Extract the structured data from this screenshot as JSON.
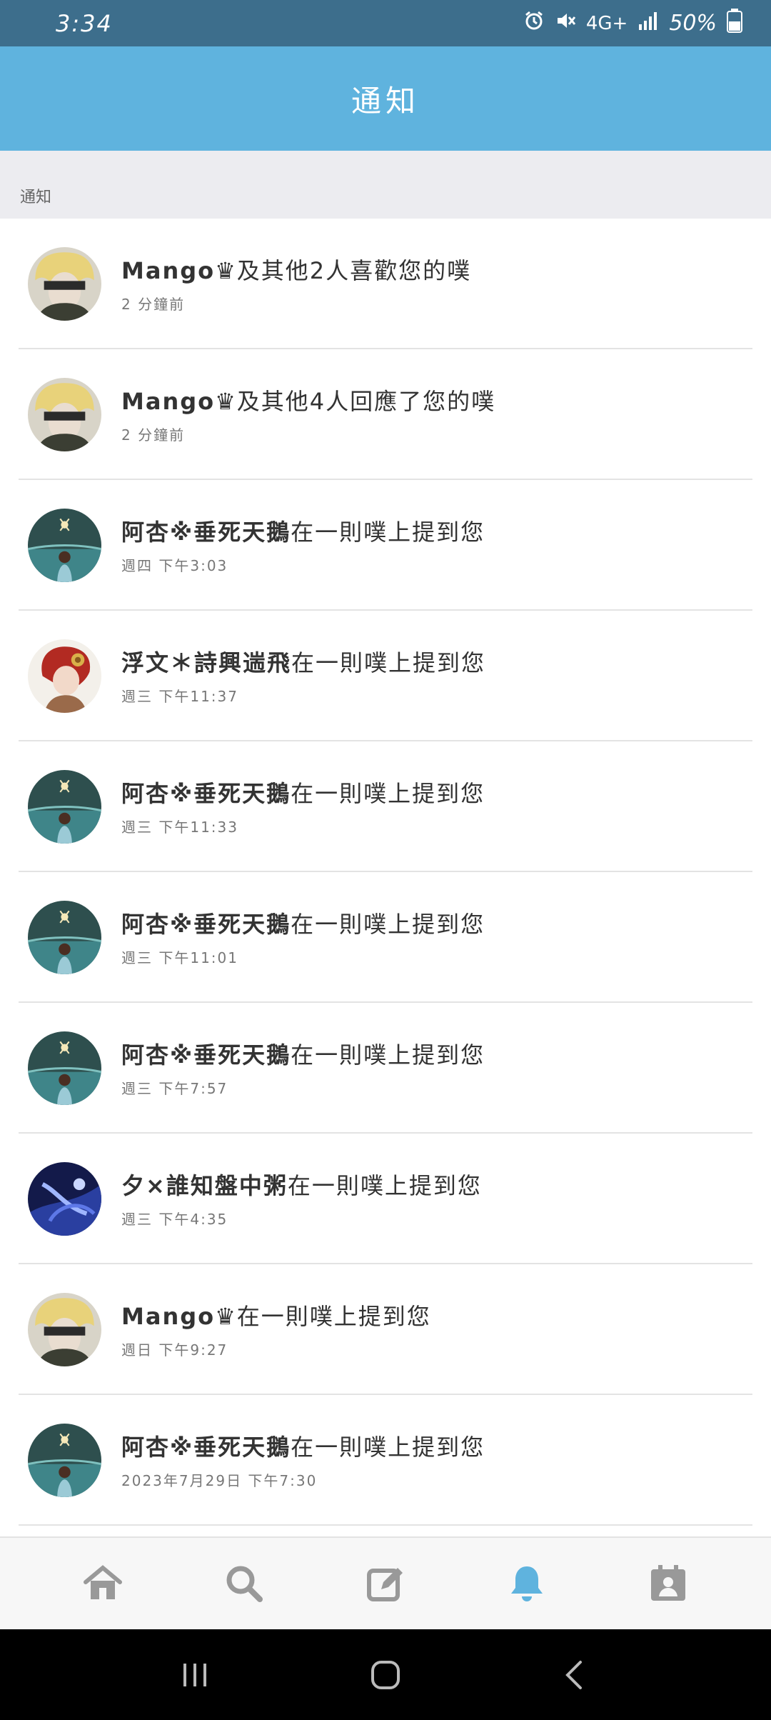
{
  "status_bar": {
    "time": "3:34",
    "network": "4G+",
    "battery": "50%",
    "icons": [
      "alarm-icon",
      "mute-icon",
      "network-icon",
      "signal-icon",
      "battery-icon"
    ]
  },
  "header": {
    "title": "通知"
  },
  "section_label": "通知",
  "notifications": [
    {
      "avatar": "avatar-blonde",
      "who": "Mango♛",
      "action": "及其他2人喜歡您的噗",
      "time": "2 分鐘前"
    },
    {
      "avatar": "avatar-blonde",
      "who": "Mango♛",
      "action": "及其他4人回應了您的噗",
      "time": "2 分鐘前"
    },
    {
      "avatar": "avatar-teal",
      "who": "阿杏※垂死天鵝",
      "action": "在一則噗上提到您",
      "time": "週四 下午3:03"
    },
    {
      "avatar": "avatar-red",
      "who": "浮文＊詩興遄飛",
      "action": "在一則噗上提到您",
      "time": "週三 下午11:37"
    },
    {
      "avatar": "avatar-teal",
      "who": "阿杏※垂死天鵝",
      "action": "在一則噗上提到您",
      "time": "週三 下午11:33"
    },
    {
      "avatar": "avatar-teal",
      "who": "阿杏※垂死天鵝",
      "action": "在一則噗上提到您",
      "time": "週三 下午11:01"
    },
    {
      "avatar": "avatar-teal",
      "who": "阿杏※垂死天鵝",
      "action": "在一則噗上提到您",
      "time": "週三 下午7:57"
    },
    {
      "avatar": "avatar-blue",
      "who": "夕×誰知盤中粥",
      "action": "在一則噗上提到您",
      "time": "週三 下午4:35"
    },
    {
      "avatar": "avatar-blonde",
      "who": "Mango♛",
      "action": "在一則噗上提到您",
      "time": "週日 下午9:27"
    },
    {
      "avatar": "avatar-teal",
      "who": "阿杏※垂死天鵝",
      "action": "在一則噗上提到您",
      "time": "2023年7月29日 下午7:30"
    }
  ],
  "bottom_nav": [
    "home-icon",
    "search-icon",
    "compose-icon",
    "bell-icon",
    "profile-icon"
  ],
  "active_nav": "bell-icon",
  "colors": {
    "status_bar": "#3d6e8c",
    "header": "#5fb3de",
    "accent": "#5fb3de",
    "section": "#ececf0"
  }
}
